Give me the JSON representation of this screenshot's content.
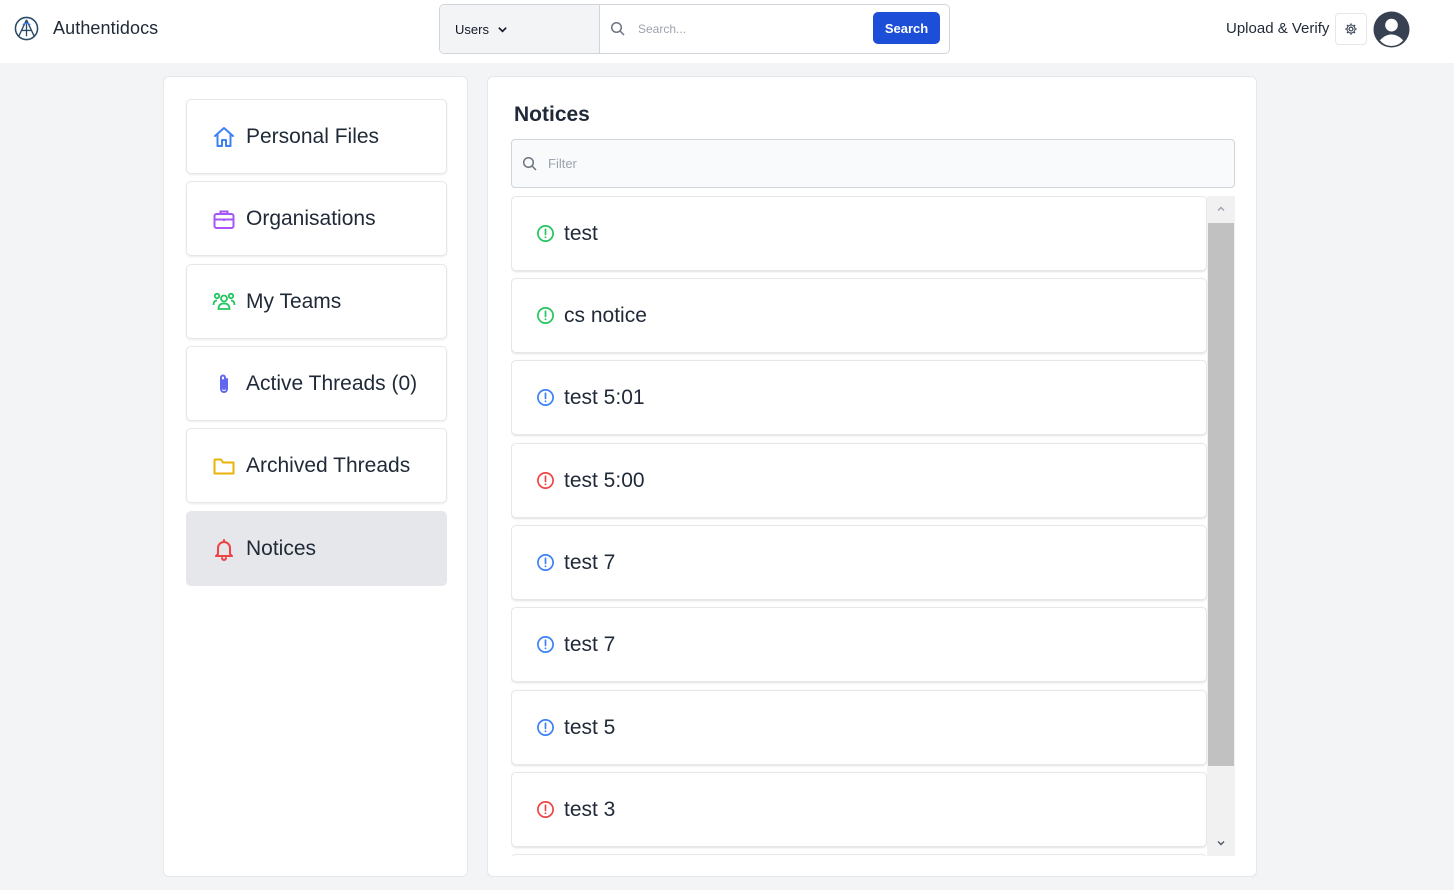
{
  "app": {
    "name": "Authentidocs"
  },
  "header": {
    "scope": {
      "selected": "Users"
    },
    "search": {
      "placeholder": "Search...",
      "button_label": "Search"
    },
    "upload_label": "Upload & Verify"
  },
  "sidebar": {
    "items": [
      {
        "label": "Personal Files",
        "icon": "home-icon",
        "color": "#3b82f6"
      },
      {
        "label": "Organisations",
        "icon": "briefcase-icon",
        "color": "#a855f7"
      },
      {
        "label": "My Teams",
        "icon": "users-icon",
        "color": "#22c55e"
      },
      {
        "label": "Active Threads (0)",
        "icon": "paperclip-icon",
        "color": "#6366f1"
      },
      {
        "label": "Archived Threads",
        "icon": "folder-icon",
        "color": "#eab308"
      },
      {
        "label": "Notices",
        "icon": "bell-icon",
        "color": "#ef4444",
        "active": true
      }
    ]
  },
  "main": {
    "title": "Notices",
    "filter": {
      "placeholder": "Filter"
    },
    "notices": [
      {
        "label": "test",
        "status_color": "#22c55e"
      },
      {
        "label": "cs notice",
        "status_color": "#22c55e"
      },
      {
        "label": "test 5:01",
        "status_color": "#3b82f6"
      },
      {
        "label": "test 5:00",
        "status_color": "#ef4444"
      },
      {
        "label": "test 7",
        "status_color": "#3b82f6"
      },
      {
        "label": "test 7",
        "status_color": "#3b82f6"
      },
      {
        "label": "test 5",
        "status_color": "#3b82f6"
      },
      {
        "label": "test 3",
        "status_color": "#ef4444"
      }
    ]
  }
}
